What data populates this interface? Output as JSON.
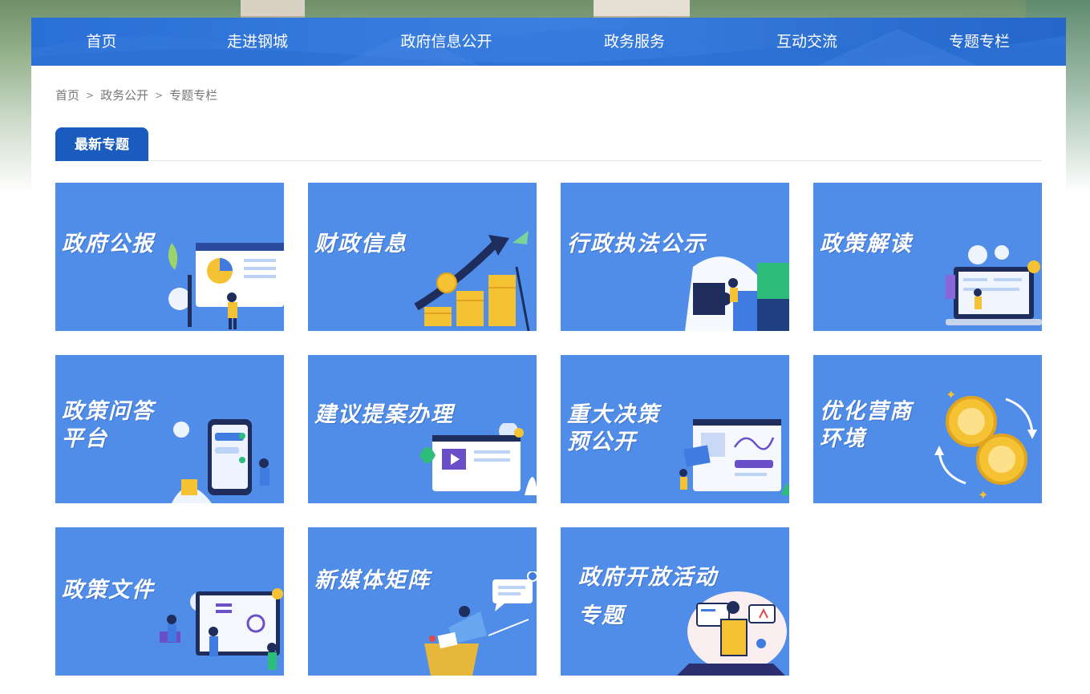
{
  "nav": {
    "items": [
      "首页",
      "走进钢城",
      "政府信息公开",
      "政务服务",
      "互动交流",
      "专题专栏"
    ]
  },
  "breadcrumb": {
    "items": [
      "首页",
      "政务公开",
      "专题专栏"
    ],
    "separator": ">"
  },
  "section": {
    "tab_label": "最新专题"
  },
  "cards": [
    {
      "line1": "政府公报",
      "line2": ""
    },
    {
      "line1": "财政信息",
      "line2": ""
    },
    {
      "line1": "行政执法公示",
      "line2": ""
    },
    {
      "line1": "政策解读",
      "line2": ""
    },
    {
      "line1": "政策问答",
      "line2": "平台"
    },
    {
      "line1": "建议提案办理",
      "line2": ""
    },
    {
      "line1": "重大决策",
      "line2": "预公开"
    },
    {
      "line1": "优化营商",
      "line2": "环境"
    },
    {
      "line1": "政策文件",
      "line2": ""
    },
    {
      "line1": "新媒体矩阵",
      "line2": ""
    },
    {
      "line1": "政府开放活动",
      "line2": "专题"
    }
  ],
  "colors": {
    "nav_bg": "#2a6fd6",
    "card_bg": "#4f8de9",
    "tab_bg": "#1a5bbf"
  }
}
